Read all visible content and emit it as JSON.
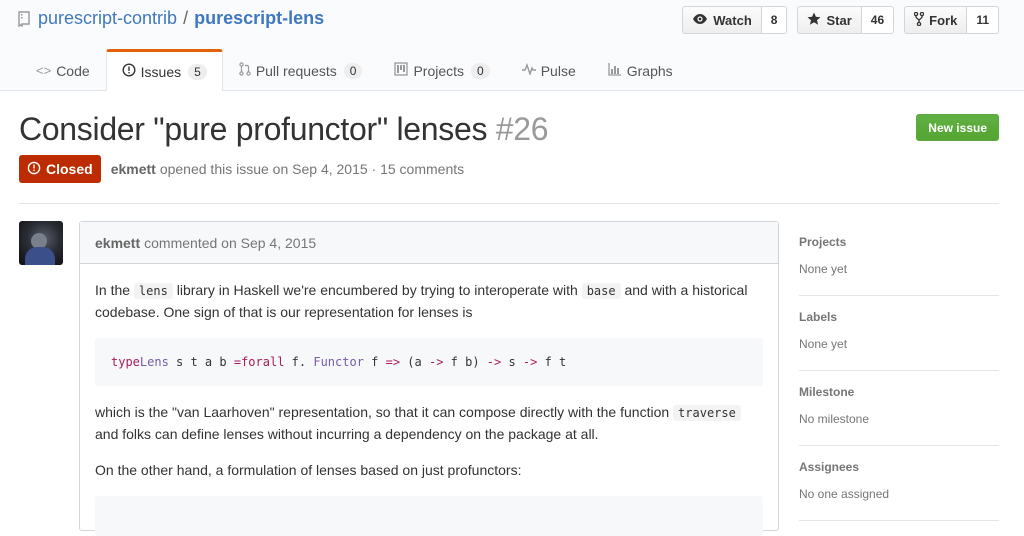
{
  "repo": {
    "owner": "purescript-contrib",
    "separator": "/",
    "name": "purescript-lens"
  },
  "actions": [
    {
      "label": "Watch",
      "count": "8",
      "icon": "eye-icon"
    },
    {
      "label": "Star",
      "count": "46",
      "icon": "star-icon"
    },
    {
      "label": "Fork",
      "count": "11",
      "icon": "fork-icon"
    }
  ],
  "nav": {
    "code": {
      "label": "Code",
      "icon": "code-icon"
    },
    "issues": {
      "label": "Issues",
      "count": "5",
      "icon": "issue-opened-icon"
    },
    "pulls": {
      "label": "Pull requests",
      "count": "0",
      "icon": "git-pull-request-icon"
    },
    "projects": {
      "label": "Projects",
      "count": "0",
      "icon": "project-icon"
    },
    "pulse": {
      "label": "Pulse",
      "icon": "pulse-icon"
    },
    "graphs": {
      "label": "Graphs",
      "icon": "graph-icon"
    }
  },
  "issue": {
    "title": "Consider \"pure profunctor\" lenses",
    "number": "#26",
    "new_issue_label": "New issue",
    "state": "Closed",
    "author": "ekmett",
    "opened_text": "opened this issue on Sep 4, 2015 · 15 comments"
  },
  "comment": {
    "author": "ekmett",
    "commented_text": "commented on Sep 4, 2015",
    "p1_a": "In the ",
    "p1_code1": "lens",
    "p1_b": " library in Haskell we're encumbered by trying to interoperate with ",
    "p1_code2": "base",
    "p1_c": " and with a historical codebase. One sign of that is our representation for lenses is",
    "code": {
      "kw_type": "type",
      "ty_lens": "Lens",
      "vars": " s t a b ",
      "op_eq": "=",
      "kw_forall": "forall",
      "f_dot": " f. ",
      "ty_functor": "Functor",
      "f_sp": " f ",
      "op_arrow_fat": "=>",
      "paren": " (a ",
      "op_arrow1": "->",
      "fb": " f b) ",
      "op_arrow2": "->",
      "s_sp": " s ",
      "op_arrow3": "->",
      "ft": " f t"
    },
    "p2_a": "which is the \"van Laarhoven\" representation, so that it can compose directly with the function ",
    "p2_code": "traverse",
    "p2_b": " and folks can define lenses without incurring a dependency on the package at all.",
    "p3": "On the other hand, a formulation of lenses based on just profunctors:"
  },
  "sidebar": [
    {
      "heading": "Projects",
      "value": "None yet"
    },
    {
      "heading": "Labels",
      "value": "None yet"
    },
    {
      "heading": "Milestone",
      "value": "No milestone"
    },
    {
      "heading": "Assignees",
      "value": "No one assigned"
    }
  ],
  "colors": {
    "link": "#4078c0",
    "closed": "#bd2c00",
    "new_issue": "#55a532",
    "tab_accent": "#e36209"
  }
}
